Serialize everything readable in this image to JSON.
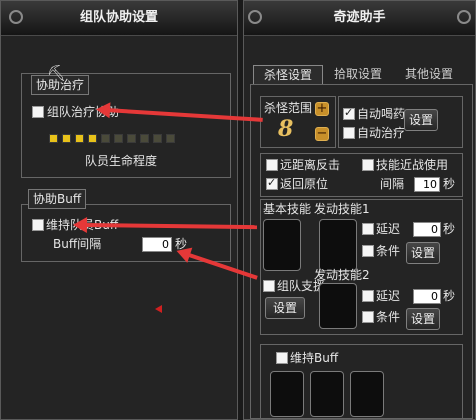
{
  "team_window": {
    "title": "组队协助设置",
    "heal_group": {
      "legend": "协助治疗",
      "checkbox_label": "组队治疗协助",
      "checked": false,
      "health_segments_filled": 4,
      "health_segments_total": 10,
      "health_caption": "队员生命程度"
    },
    "buff_group": {
      "legend": "协助Buff",
      "checkbox_label": "维持队员Buff",
      "checked": false,
      "interval_label": "Buff间隔",
      "interval_value": "0",
      "interval_unit": "秒"
    }
  },
  "miracle_window": {
    "title": "奇迹助手",
    "tabs": [
      {
        "label": "杀怪设置",
        "active": true
      },
      {
        "label": "拾取设置",
        "active": false
      },
      {
        "label": "其他设置",
        "active": false
      }
    ],
    "kill_range": {
      "label": "杀怪范围",
      "value": "8",
      "plus": "+",
      "minus": "−"
    },
    "auto_potion": {
      "label": "自动喝药",
      "checked": true
    },
    "auto_heal": {
      "label": "自动治疗",
      "checked": false
    },
    "potion_settings_button": "设置",
    "long_range_counter": {
      "label": "远距离反击",
      "checked": false
    },
    "skill_melee_use": {
      "label": "技能近战使用",
      "checked": false
    },
    "return_origin": {
      "label": "返回原位",
      "checked": true
    },
    "interval": {
      "label": "间隔",
      "value": "10",
      "unit": "秒"
    },
    "basic_skill_label": "基本技能",
    "active_skill1_label": "发动技能1",
    "skill1_delay": {
      "label": "延迟",
      "checked": false,
      "value": "0",
      "unit": "秒"
    },
    "skill1_condition": {
      "label": "条件",
      "checked": false
    },
    "skill1_settings_button": "设置",
    "party_support": {
      "label": "组队支援",
      "checked": false
    },
    "party_settings_button": "设置",
    "active_skill2_label": "发动技能2",
    "skill2_delay": {
      "label": "延迟",
      "checked": false,
      "value": "0",
      "unit": "秒"
    },
    "skill2_condition": {
      "label": "条件",
      "checked": false
    },
    "skill2_settings_button": "设置",
    "maintain_buff": {
      "label": "维持Buff",
      "checked": false
    }
  },
  "colors": {
    "annotation_arrow": "#e53838",
    "health_filled": "#e8c21a",
    "health_empty": "#4a4a3a"
  }
}
